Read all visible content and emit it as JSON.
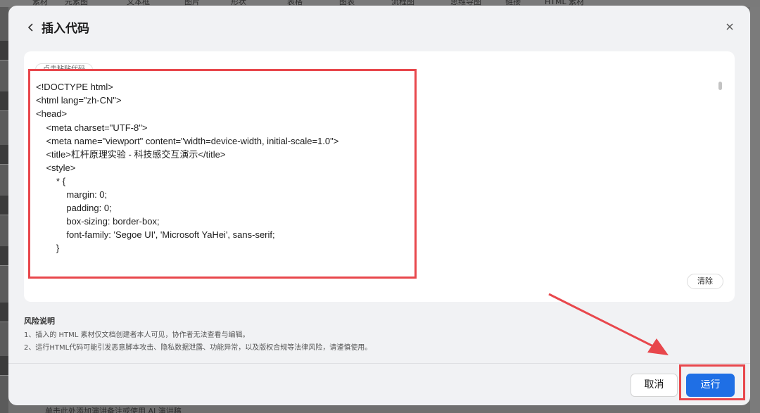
{
  "background": {
    "toolbar_items": [
      "素材",
      "元素图",
      "文本框",
      "图片",
      "形状",
      "表格",
      "图表",
      "流程图",
      "思维导图",
      "链接",
      "HTML 素材"
    ],
    "bottom_hint": "单击此处添加演讲备注或使用 AI 演讲稿"
  },
  "dialog": {
    "title": "插入代码",
    "back_icon": "chevron-left-icon",
    "close_icon": "close-icon",
    "paste_tag": "点击粘贴代码",
    "code_lines": [
      "<!DOCTYPE html>",
      "<html lang=\"zh-CN\">",
      "<head>",
      "    <meta charset=\"UTF-8\">",
      "    <meta name=\"viewport\" content=\"width=device-width, initial-scale=1.0\">",
      "    <title>杠杆原理实验 - 科技感交互演示</title>",
      "    <style>",
      "        * {",
      "            margin: 0;",
      "            padding: 0;",
      "            box-sizing: border-box;",
      "            font-family: 'Segoe UI', 'Microsoft YaHei', sans-serif;",
      "        }"
    ],
    "clear_label": "清除",
    "risk": {
      "title": "风险说明",
      "lines": [
        "1、插入的 HTML 素材仅文档创建者本人可见，协作者无法查看与编辑。",
        "2、运行HTML代码可能引发恶意脚本攻击、隐私数据泄露、功能异常，以及版权合规等法律风险，请谨慎使用。"
      ]
    },
    "cancel_label": "取消",
    "run_label": "运行"
  },
  "colors": {
    "accent": "#1f6fe5",
    "annotation": "#e8474c"
  }
}
